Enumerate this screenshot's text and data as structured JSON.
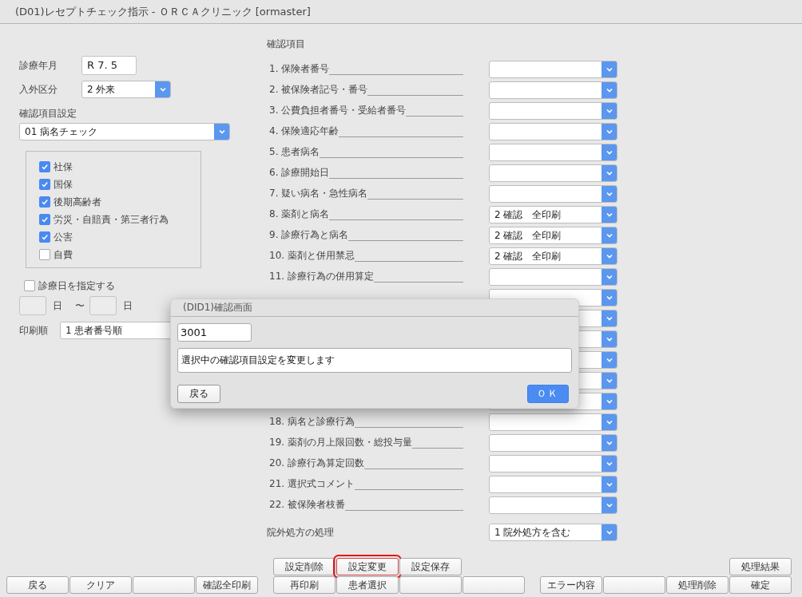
{
  "window": {
    "title": "(D01)レセプトチェック指示 - ＯＲＣＡクリニック [ormaster]"
  },
  "left": {
    "year_month": {
      "label": "診療年月",
      "value": "R 7. 5"
    },
    "inout": {
      "label": "入外区分",
      "value": "2 外来"
    },
    "setting": {
      "label": "確認項目設定",
      "value": "01 病名チェック"
    },
    "insurance": [
      {
        "label": "社保",
        "checked": true
      },
      {
        "label": "国保",
        "checked": true
      },
      {
        "label": "後期高齢者",
        "checked": true
      },
      {
        "label": "労災・自賠責・第三者行為",
        "checked": true
      },
      {
        "label": "公害",
        "checked": true
      },
      {
        "label": "自費",
        "checked": false
      }
    ],
    "date_filter": {
      "label": "診療日を指定する",
      "checked": false,
      "from_unit": "日",
      "tilde": "〜",
      "to_unit": "日"
    },
    "print_order": {
      "label": "印刷順",
      "value": "1 患者番号順"
    }
  },
  "check_items": {
    "title": "確認項目",
    "items": [
      {
        "kind": "item",
        "label": "1. 保険者番号"
      },
      {
        "kind": "item",
        "label": "2. 被保険者記号・番号"
      },
      {
        "kind": "item",
        "label": "3. 公費負担者番号・受給者番号"
      },
      {
        "kind": "item",
        "label": "4. 保険適応年齢"
      },
      {
        "kind": "item",
        "label": "5. 患者病名"
      },
      {
        "kind": "item",
        "label": "6. 診療開始日"
      },
      {
        "kind": "item",
        "label": "7. 疑い病名・急性病名"
      },
      {
        "kind": "item",
        "label": "8. 薬剤と病名",
        "value": "2 確認　全印刷"
      },
      {
        "kind": "item",
        "label": "9. 診療行為と病名",
        "value": "2 確認　全印刷"
      },
      {
        "kind": "item",
        "label": "10. 薬剤と併用禁忌",
        "value": "2 確認　全印刷"
      },
      {
        "kind": "item",
        "label": "11. 診療行為の併用算定"
      },
      {
        "kind": "covered"
      },
      {
        "kind": "covered"
      },
      {
        "kind": "covered"
      },
      {
        "kind": "covered"
      },
      {
        "kind": "covered"
      },
      {
        "kind": "covered"
      },
      {
        "kind": "item",
        "label": "18. 病名と診療行為"
      },
      {
        "kind": "item",
        "label": "19. 薬剤の月上限回数・総投与量"
      },
      {
        "kind": "item",
        "label": "20. 診療行為算定回数"
      },
      {
        "kind": "item",
        "label": "21. 選択式コメント"
      },
      {
        "kind": "item",
        "label": "22. 被保険者枝番"
      }
    ]
  },
  "outside_rx": {
    "label": "院外処方の処理",
    "value": "1 院外処方を含む"
  },
  "function_keys": [
    {
      "bottom": [
        {
          "kind": "key",
          "label": "戻る",
          "highlighted": false
        },
        {
          "kind": "key",
          "label": "クリア",
          "highlighted": false
        },
        {
          "kind": "blank",
          "highlighted": false
        },
        {
          "kind": "key",
          "label": "確認全印刷",
          "highlighted": false
        }
      ]
    },
    {
      "top": [
        {
          "kind": "key",
          "label": "設定削除",
          "highlighted": false
        },
        {
          "kind": "key",
          "label": "設定変更",
          "highlighted": true
        },
        {
          "kind": "key",
          "label": "設定保存",
          "highlighted": false
        }
      ],
      "bottom": [
        {
          "kind": "key",
          "label": "再印刷",
          "highlighted": false
        },
        {
          "kind": "key",
          "label": "患者選択",
          "highlighted": false
        },
        {
          "kind": "blank",
          "highlighted": false
        },
        {
          "kind": "blank",
          "highlighted": false
        }
      ]
    },
    {
      "top": [
        {
          "kind": "empty"
        },
        {
          "kind": "empty"
        },
        {
          "kind": "empty"
        },
        {
          "kind": "key",
          "label": "処理結果",
          "highlighted": false
        }
      ],
      "bottom": [
        {
          "kind": "key",
          "label": "エラー内容",
          "highlighted": false
        },
        {
          "kind": "blank",
          "highlighted": false
        },
        {
          "kind": "key",
          "label": "処理削除",
          "highlighted": false
        },
        {
          "kind": "key",
          "label": "確定",
          "highlighted": false
        }
      ]
    }
  ],
  "dialog": {
    "title": "(DID1)確認画面",
    "code": "3001",
    "message": "選択中の確認項目設定を変更します",
    "buttons": [
      {
        "kind": "back",
        "label": "戻る"
      },
      {
        "kind": "ok",
        "label": "ＯＫ"
      }
    ]
  }
}
